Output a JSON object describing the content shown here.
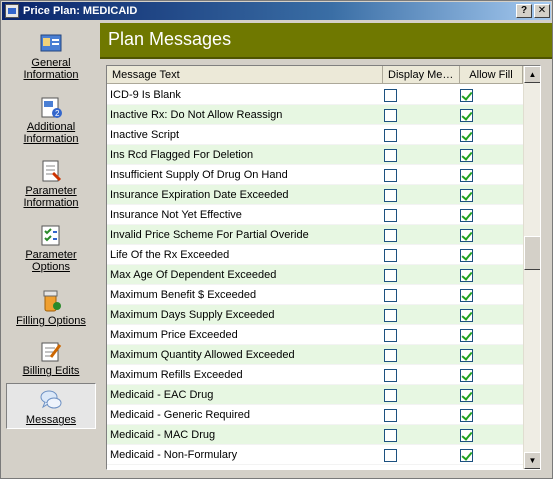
{
  "window": {
    "title": "Price Plan: MEDICAID",
    "help_label": "?",
    "close_label": "✕"
  },
  "sidebar": {
    "items": [
      {
        "label": "General Information",
        "icon": "general-info-icon"
      },
      {
        "label": "Additional Information",
        "icon": "additional-info-icon"
      },
      {
        "label": "Parameter Information",
        "icon": "parameter-info-icon"
      },
      {
        "label": "Parameter Options",
        "icon": "parameter-options-icon"
      },
      {
        "label": "Filling Options",
        "icon": "filling-options-icon"
      },
      {
        "label": "Billing Edits",
        "icon": "billing-edits-icon"
      },
      {
        "label": "Messages",
        "icon": "messages-icon",
        "active": true
      }
    ]
  },
  "main": {
    "heading": "Plan Messages",
    "columns": {
      "message_text": "Message Text",
      "display": "Display Me…",
      "allow_fill": "Allow Fill"
    },
    "rows": [
      {
        "text": "ICD-9 Is Blank",
        "display": false,
        "allow_fill": true
      },
      {
        "text": "Inactive Rx: Do Not Allow Reassign",
        "display": false,
        "allow_fill": true
      },
      {
        "text": "Inactive Script",
        "display": false,
        "allow_fill": true
      },
      {
        "text": "Ins Rcd Flagged For Deletion",
        "display": false,
        "allow_fill": true
      },
      {
        "text": "Insufficient Supply Of Drug On Hand",
        "display": false,
        "allow_fill": true
      },
      {
        "text": "Insurance Expiration Date Exceeded",
        "display": false,
        "allow_fill": true
      },
      {
        "text": "Insurance Not Yet Effective",
        "display": false,
        "allow_fill": true
      },
      {
        "text": "Invalid Price Scheme For Partial Overide",
        "display": false,
        "allow_fill": true
      },
      {
        "text": "Life Of the Rx Exceeded",
        "display": false,
        "allow_fill": true
      },
      {
        "text": "Max Age Of Dependent Exceeded",
        "display": false,
        "allow_fill": true
      },
      {
        "text": "Maximum Benefit $ Exceeded",
        "display": false,
        "allow_fill": true
      },
      {
        "text": "Maximum Days Supply Exceeded",
        "display": false,
        "allow_fill": true
      },
      {
        "text": "Maximum Price Exceeded",
        "display": false,
        "allow_fill": true
      },
      {
        "text": "Maximum Quantity Allowed Exceeded",
        "display": false,
        "allow_fill": true
      },
      {
        "text": "Maximum Refills Exceeded",
        "display": false,
        "allow_fill": true
      },
      {
        "text": "Medicaid - EAC Drug",
        "display": false,
        "allow_fill": true
      },
      {
        "text": "Medicaid - Generic Required",
        "display": false,
        "allow_fill": true
      },
      {
        "text": "Medicaid - MAC Drug",
        "display": false,
        "allow_fill": true
      },
      {
        "text": "Medicaid - Non-Formulary",
        "display": false,
        "allow_fill": true
      }
    ]
  },
  "scrollbar": {
    "up_arrow": "▲",
    "down_arrow": "▼"
  },
  "colors": {
    "header_band": "#6f7800",
    "row_alt": "#e7f7e2",
    "check": "#21a121",
    "titlebar": "#0a246a"
  }
}
